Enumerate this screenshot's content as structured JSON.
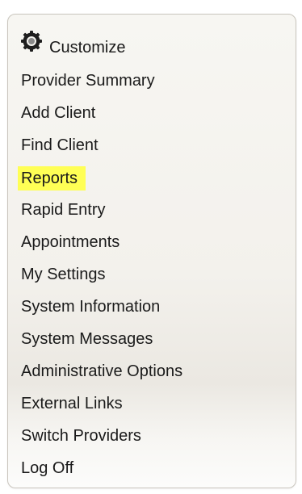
{
  "menu": {
    "customize": {
      "label": "Customize",
      "icon": "gear-icon"
    },
    "items": [
      {
        "label": "Provider Summary"
      },
      {
        "label": "Add Client"
      },
      {
        "label": "Find Client"
      },
      {
        "label": "Reports",
        "highlight_color": "#ffff55"
      },
      {
        "label": "Rapid Entry"
      },
      {
        "label": "Appointments"
      },
      {
        "label": "My Settings"
      },
      {
        "label": "System Information"
      },
      {
        "label": "System Messages"
      },
      {
        "label": "Administrative Options"
      },
      {
        "label": "External Links"
      },
      {
        "label": "Switch Providers"
      },
      {
        "label": "Log Off"
      }
    ]
  }
}
